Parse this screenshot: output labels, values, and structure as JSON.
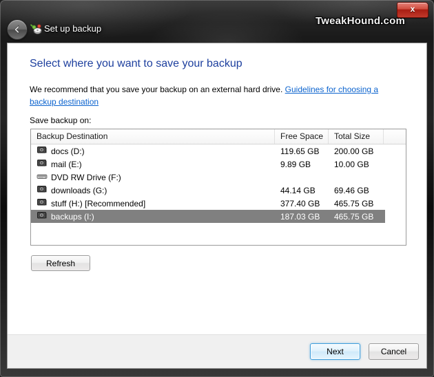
{
  "window": {
    "title": "Set up backup",
    "watermark": "TweakHound.com",
    "close_label": "x",
    "back_icon": "back-arrow-icon",
    "app_icon": "backup-icon"
  },
  "page": {
    "heading": "Select where you want to save your backup",
    "description_before": "We recommend that you save your backup on an external hard drive. ",
    "link_text": "Guidelines for choosing a backup destination",
    "list_label": "Save backup on:"
  },
  "list": {
    "columns": [
      {
        "label": "Backup Destination"
      },
      {
        "label": "Free Space"
      },
      {
        "label": "Total Size"
      },
      {
        "label": ""
      }
    ],
    "rows": [
      {
        "name": "docs (D:)",
        "free_space": "119.65 GB",
        "total_size": "200.00 GB",
        "icon": "hard-drive-icon",
        "selected": false
      },
      {
        "name": "mail (E:)",
        "free_space": "9.89 GB",
        "total_size": "10.00 GB",
        "icon": "hard-drive-icon",
        "selected": false
      },
      {
        "name": "DVD RW Drive (F:)",
        "free_space": "",
        "total_size": "",
        "icon": "dvd-drive-icon",
        "selected": false
      },
      {
        "name": "downloads (G:)",
        "free_space": "44.14 GB",
        "total_size": "69.46 GB",
        "icon": "hard-drive-icon",
        "selected": false
      },
      {
        "name": "stuff (H:) [Recommended]",
        "free_space": "377.40 GB",
        "total_size": "465.75 GB",
        "icon": "hard-drive-icon",
        "selected": false
      },
      {
        "name": "backups (I:)",
        "free_space": "187.03 GB",
        "total_size": "465.75 GB",
        "icon": "hard-drive-icon",
        "selected": true
      }
    ]
  },
  "buttons": {
    "refresh": "Refresh",
    "next": "Next",
    "cancel": "Cancel"
  },
  "colors": {
    "heading": "#1d3f9e",
    "link": "#0b63ce",
    "selection": "#808080",
    "default_button_border": "#3c9ddb",
    "close_button": "#c0392b"
  }
}
